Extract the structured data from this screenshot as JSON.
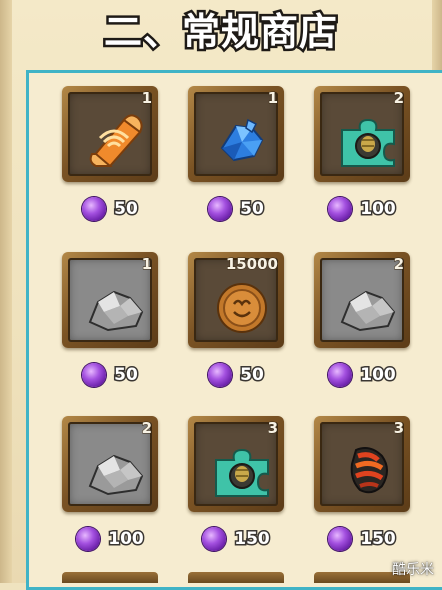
{
  "page": {
    "title": "二、常规商店",
    "watermark": "酷乐米"
  },
  "colors": {
    "panel_border": "#40b3c6",
    "slot_frame": "#7a5324",
    "currency_gem": "#a451e0",
    "background": "#efe3bf"
  },
  "shop": {
    "currency_icon": "purple-gem-icon",
    "items": [
      {
        "icon": "scroll-icon",
        "quantity": "1",
        "price": "50"
      },
      {
        "icon": "blue-crystal-icon",
        "quantity": "1",
        "price": "50"
      },
      {
        "icon": "puzzle-piece-icon",
        "quantity": "2",
        "price": "100"
      },
      {
        "icon": "grey-ore-icon",
        "quantity": "1",
        "price": "50"
      },
      {
        "icon": "bronze-coin-icon",
        "quantity": "15000",
        "price": "50"
      },
      {
        "icon": "grey-ore-icon",
        "quantity": "2",
        "price": "100"
      },
      {
        "icon": "grey-ore-icon",
        "quantity": "2",
        "price": "100"
      },
      {
        "icon": "puzzle-piece-icon",
        "quantity": "3",
        "price": "150"
      },
      {
        "icon": "fire-shell-icon",
        "quantity": "3",
        "price": "150"
      }
    ]
  }
}
